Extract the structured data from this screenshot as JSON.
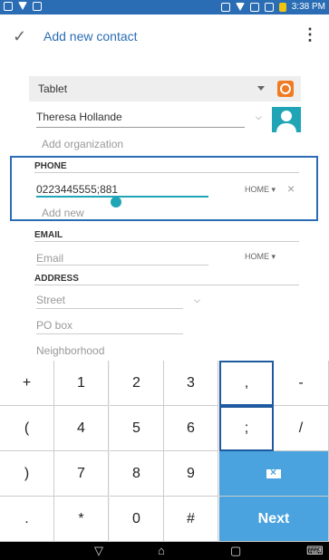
{
  "status_bar": {
    "time": "3:38 PM"
  },
  "app_bar": {
    "title": "Add new contact"
  },
  "form": {
    "account_type": "Tablet",
    "name": "Theresa Hollande",
    "organization_placeholder": "Add organization",
    "phone_label": "PHONE",
    "phone_value": "0223445555;881",
    "phone_type": "HOME",
    "add_new": "Add new",
    "email_label": "EMAIL",
    "email_placeholder": "Email",
    "email_type": "HOME",
    "address_label": "ADDRESS",
    "street_placeholder": "Street",
    "pobox_placeholder": "PO box",
    "neighborhood_placeholder": "Neighborhood"
  },
  "keyboard": {
    "keys": [
      {
        "label": "+",
        "name": "key-plus"
      },
      {
        "label": "1",
        "name": "key-1"
      },
      {
        "label": "2",
        "name": "key-2"
      },
      {
        "label": "3",
        "name": "key-3"
      },
      {
        "label": ",",
        "name": "key-comma"
      },
      {
        "label": "-",
        "name": "key-minus"
      },
      {
        "label": "(",
        "name": "key-open-paren"
      },
      {
        "label": "4",
        "name": "key-4"
      },
      {
        "label": "5",
        "name": "key-5"
      },
      {
        "label": "6",
        "name": "key-6"
      },
      {
        "label": ";",
        "name": "key-semicolon"
      },
      {
        "label": "/",
        "name": "key-slash"
      },
      {
        "label": ")",
        "name": "key-close-paren"
      },
      {
        "label": "7",
        "name": "key-7"
      },
      {
        "label": "8",
        "name": "key-8"
      },
      {
        "label": "9",
        "name": "key-9"
      },
      {
        "label": ".",
        "name": "key-period"
      },
      {
        "label": "*",
        "name": "key-asterisk"
      },
      {
        "label": "0",
        "name": "key-0"
      },
      {
        "label": "#",
        "name": "key-hash"
      }
    ],
    "next_label": "Next"
  }
}
